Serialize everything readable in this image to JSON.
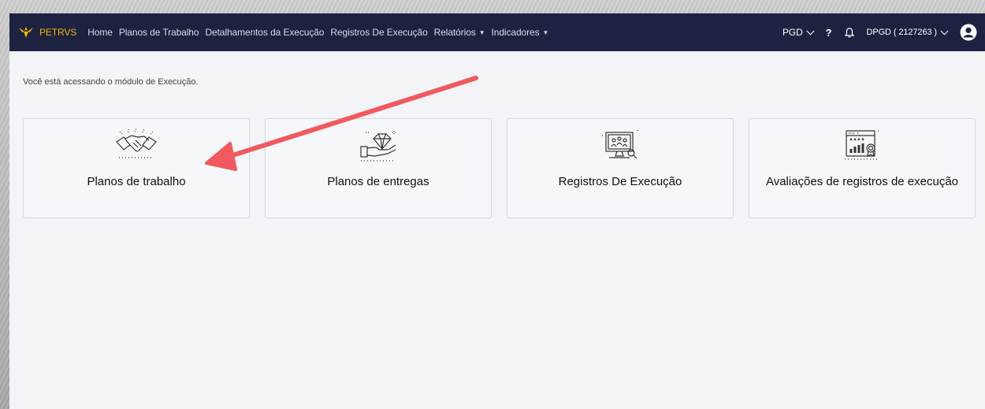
{
  "app": {
    "brand": "PETRVS"
  },
  "nav": {
    "items": [
      {
        "label": "Home",
        "dropdown": false
      },
      {
        "label": "Planos de Trabalho",
        "dropdown": false
      },
      {
        "label": "Detalhamentos da Execução",
        "dropdown": false
      },
      {
        "label": "Registros De Execução",
        "dropdown": false
      },
      {
        "label": "Relatórios",
        "dropdown": true
      },
      {
        "label": "Indicadores",
        "dropdown": true
      }
    ]
  },
  "user": {
    "module": "PGD",
    "help": "?",
    "unit": "DPGD ( 2127263 )"
  },
  "page": {
    "info": "Você está acessando o módulo de Execução."
  },
  "cards": [
    {
      "label": "Planos de trabalho",
      "icon": "handshake-icon"
    },
    {
      "label": "Planos de entregas",
      "icon": "diamond-hand-icon"
    },
    {
      "label": "Registros De Execução",
      "icon": "monitor-people-icon"
    },
    {
      "label": "Avaliações de registros de execução",
      "icon": "rating-chart-icon"
    }
  ],
  "colors": {
    "topbar": "#1d2240",
    "brand": "#f4b400",
    "background": "#f3f4f8",
    "arrow": "#f05a5e"
  }
}
